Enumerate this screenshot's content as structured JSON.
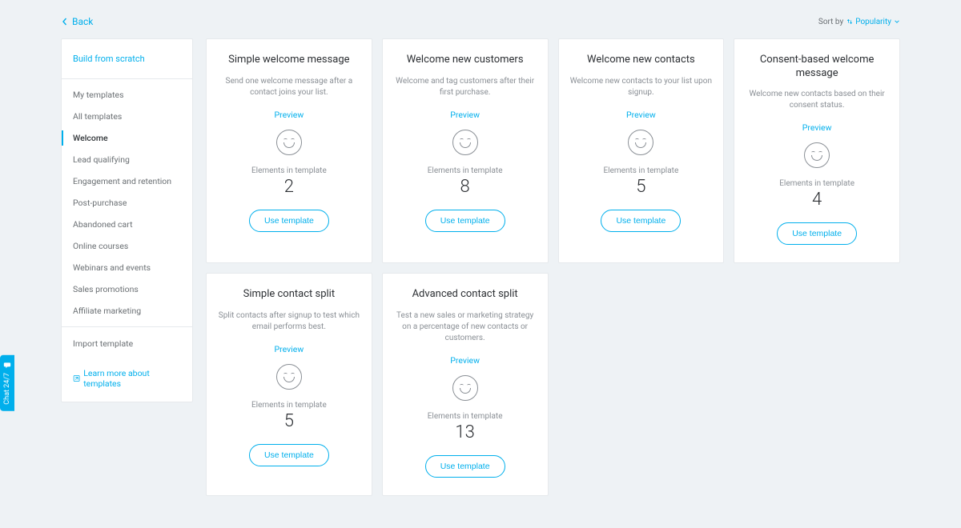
{
  "back_label": "Back",
  "sort": {
    "by_label": "Sort by",
    "value": "Popularity"
  },
  "sidebar": {
    "build_from_scratch": "Build from scratch",
    "items": [
      {
        "label": "My templates",
        "active": false
      },
      {
        "label": "All templates",
        "active": false
      },
      {
        "label": "Welcome",
        "active": true
      },
      {
        "label": "Lead qualifying",
        "active": false
      },
      {
        "label": "Engagement and retention",
        "active": false
      },
      {
        "label": "Post-purchase",
        "active": false
      },
      {
        "label": "Abandoned cart",
        "active": false
      },
      {
        "label": "Online courses",
        "active": false
      },
      {
        "label": "Webinars and events",
        "active": false
      },
      {
        "label": "Sales promotions",
        "active": false
      },
      {
        "label": "Affiliate marketing",
        "active": false
      }
    ],
    "import_template": "Import template",
    "learn_more": "Learn more about templates"
  },
  "card_labels": {
    "preview": "Preview",
    "elements": "Elements in template",
    "use": "Use template"
  },
  "templates": [
    {
      "title": "Simple welcome message",
      "desc": "Send one welcome message after a contact joins your list.",
      "elements": 2
    },
    {
      "title": "Welcome new customers",
      "desc": "Welcome and tag customers after their first purchase.",
      "elements": 8
    },
    {
      "title": "Welcome new contacts",
      "desc": "Welcome new contacts to your list upon signup.",
      "elements": 5
    },
    {
      "title": "Consent-based welcome message",
      "desc": "Welcome new contacts based on their consent status.",
      "elements": 4
    },
    {
      "title": "Simple contact split",
      "desc": "Split contacts after signup to test which email performs best.",
      "elements": 5
    },
    {
      "title": "Advanced contact split",
      "desc": "Test a new sales or marketing strategy on a percentage of new contacts or customers.",
      "elements": 13
    }
  ],
  "chat_label": "Chat 24/7"
}
